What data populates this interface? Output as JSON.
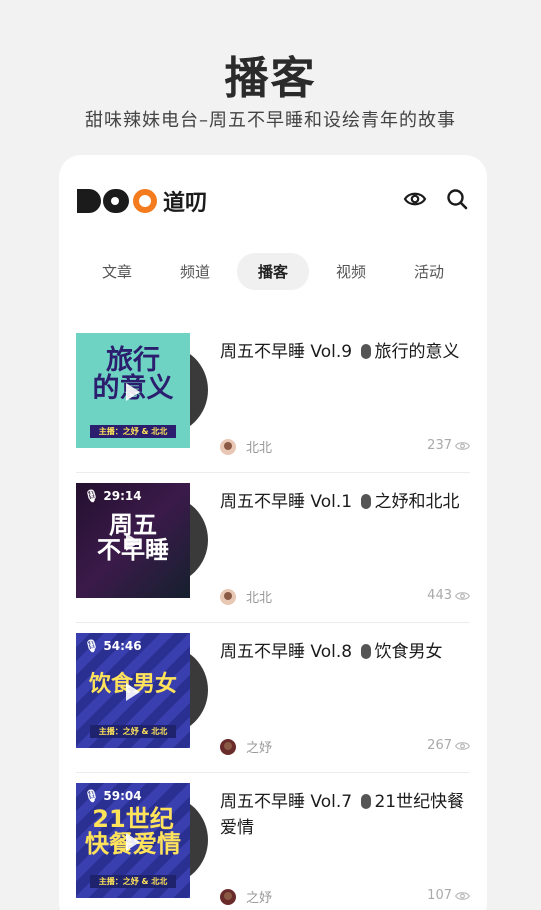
{
  "page": {
    "title": "播客",
    "subtitle": "甜味辣妹电台–周五不早睡和设绘青年的故事"
  },
  "app": {
    "logo_text": "道叨",
    "icons": [
      "eye-icon",
      "search-icon"
    ]
  },
  "tabs": [
    {
      "label": "文章",
      "active": false
    },
    {
      "label": "频道",
      "active": false
    },
    {
      "label": "播客",
      "active": true
    },
    {
      "label": "视频",
      "active": false
    },
    {
      "label": "活动",
      "active": false
    }
  ],
  "episodes": [
    {
      "title": "周五不早睡 Vol.9 ",
      "title_suffix": "旅行的意义",
      "cover_text": "旅行\n的意义",
      "duration": "",
      "host_strip": "主播：之妤 & 北北",
      "author": "北北",
      "views": "237"
    },
    {
      "title": "周五不早睡 Vol.1 ",
      "title_suffix": "之妤和北北",
      "cover_text": "周五\n不早睡",
      "duration": "29:14",
      "host_strip": "",
      "author": "北北",
      "views": "443"
    },
    {
      "title": "周五不早睡 Vol.8 ",
      "title_suffix": "饮食男女",
      "cover_text": "饮食男女",
      "duration": "54:46",
      "host_strip": "主播：之妤 & 北北",
      "author": "之妤",
      "views": "267"
    },
    {
      "title": "周五不早睡 Vol.7 ",
      "title_suffix": "21世纪快餐爱情",
      "cover_text": "21世纪\n快餐爱情",
      "duration": "59:04",
      "host_strip": "主播：之妤 & 北北",
      "author": "之妤",
      "views": "107"
    }
  ]
}
